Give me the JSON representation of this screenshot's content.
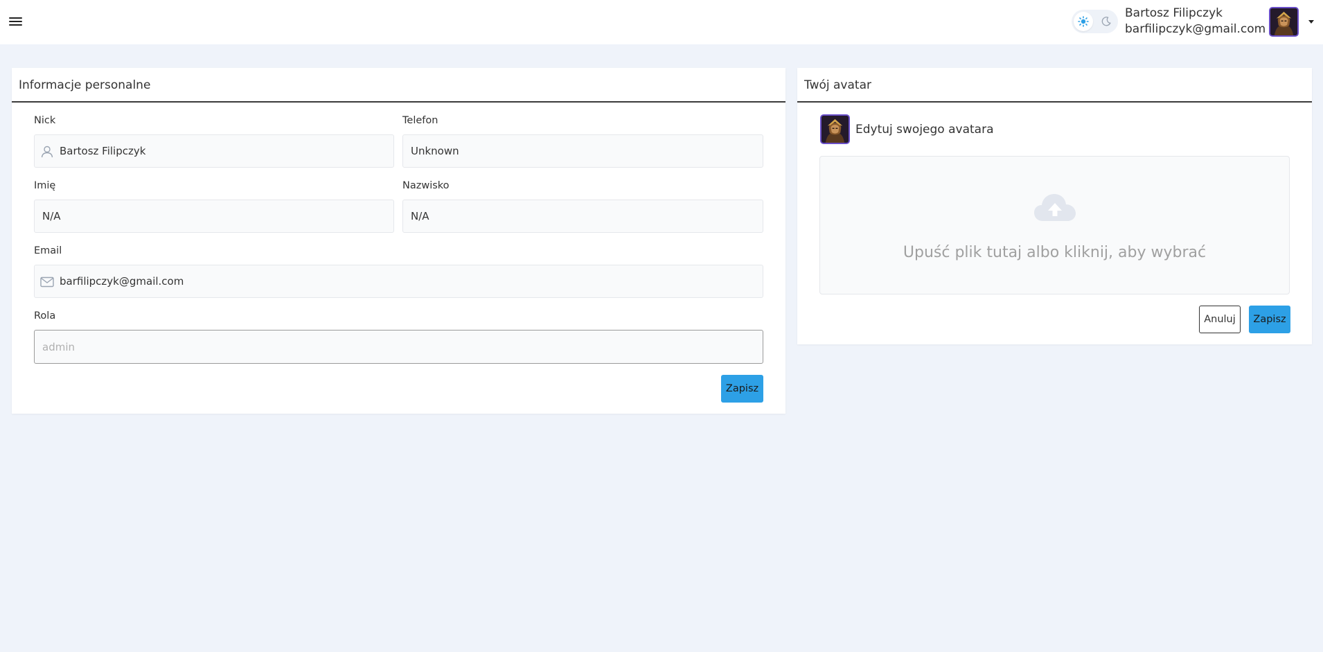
{
  "header": {
    "menu_icon": "hamburger-menu-icon",
    "theme": {
      "light_icon": "sun-icon",
      "dark_icon": "moon-icon",
      "active": "light",
      "accent": "#2da0e6"
    },
    "user": {
      "name": "Bartosz Filipczyk",
      "email": "barfilipczyk@gmail.com",
      "avatar_icon": "user-avatar-image",
      "menu_icon": "caret-down-icon"
    }
  },
  "personal_info": {
    "title": "Informacje personalne",
    "fields": {
      "nick": {
        "label": "Nick",
        "value": "Bartosz Filipczyk",
        "icon": "user-icon"
      },
      "phone": {
        "label": "Telefon",
        "value": "Unknown"
      },
      "first_name": {
        "label": "Imię",
        "value": "N/A"
      },
      "last_name": {
        "label": "Nazwisko",
        "value": "N/A"
      },
      "email": {
        "label": "Email",
        "value": "barfilipczyk@gmail.com",
        "icon": "envelope-icon"
      },
      "role": {
        "label": "Rola",
        "placeholder": "admin",
        "value": ""
      }
    },
    "save_label": "Zapisz"
  },
  "avatar_section": {
    "title": "Twój avatar",
    "edit_label": "Edytuj swojego avatara",
    "dropzone": {
      "icon": "cloud-upload-icon",
      "text": "Upuść plik tutaj albo kliknij, aby wybrać"
    },
    "cancel_label": "Anuluj",
    "save_label": "Zapisz"
  },
  "colors": {
    "background": "#eff3fa",
    "card": "#ffffff",
    "primary_button": "#2da0e6",
    "avatar_border": "#6a4fc9"
  }
}
